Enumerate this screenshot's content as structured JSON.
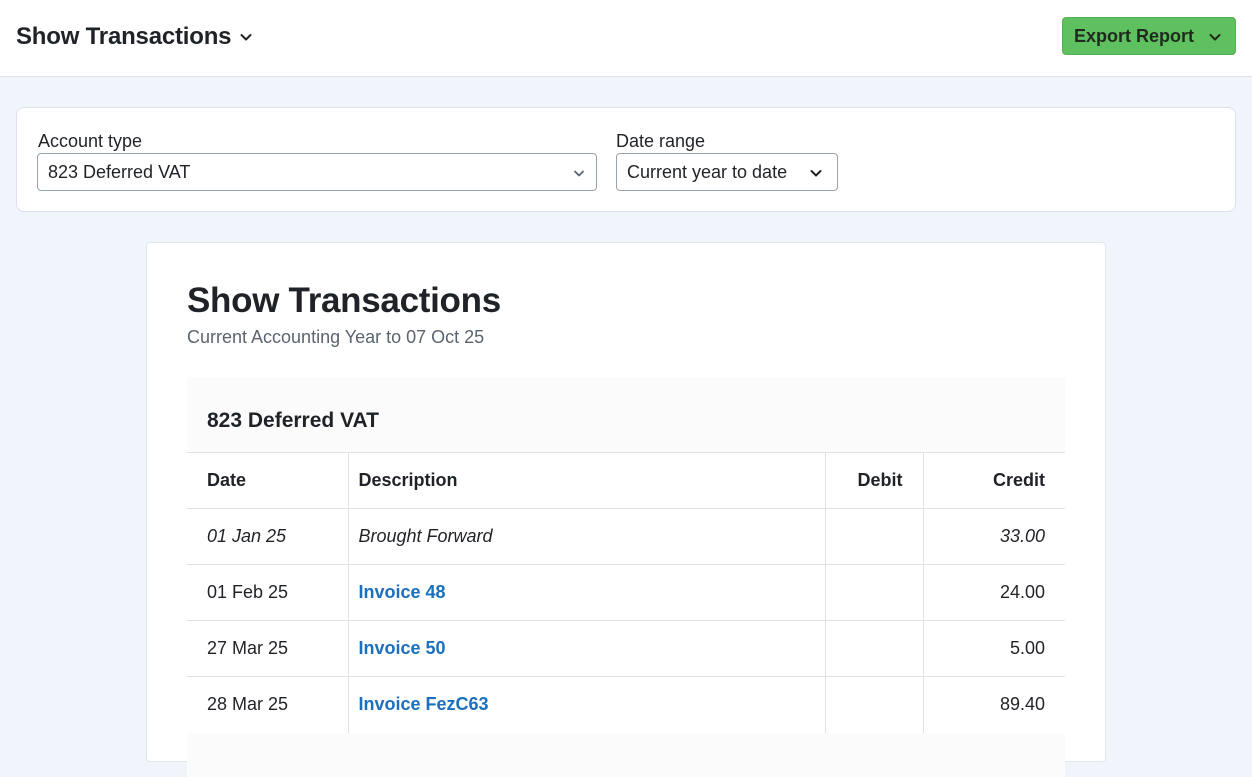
{
  "header": {
    "page_menu_label": "Show Transactions",
    "export_label": "Export Report"
  },
  "filters": {
    "account_type_label": "Account type",
    "account_type_value": "823 Deferred VAT",
    "date_range_label": "Date range",
    "date_range_value": "Current year to date"
  },
  "report": {
    "title": "Show Transactions",
    "subtitle": "Current Accounting Year to 07 Oct 25",
    "account_name": "823 Deferred VAT",
    "columns": {
      "date": "Date",
      "description": "Description",
      "debit": "Debit",
      "credit": "Credit"
    },
    "rows": [
      {
        "date": "01 Jan 25",
        "description": "Brought Forward",
        "debit": "",
        "credit": "33.00"
      },
      {
        "date": "01 Feb 25",
        "description": "Invoice 48",
        "debit": "",
        "credit": "24.00"
      },
      {
        "date": "27 Mar 25",
        "description": "Invoice 50",
        "debit": "",
        "credit": "5.00"
      },
      {
        "date": "28 Mar 25",
        "description": "Invoice FezC63",
        "debit": "",
        "credit": "89.40"
      }
    ]
  },
  "colors": {
    "accent_green": "#5fc05f",
    "link_blue": "#1a6fbf",
    "page_background": "#f0f5fc"
  },
  "icons": [
    "chevron-down-icon"
  ]
}
